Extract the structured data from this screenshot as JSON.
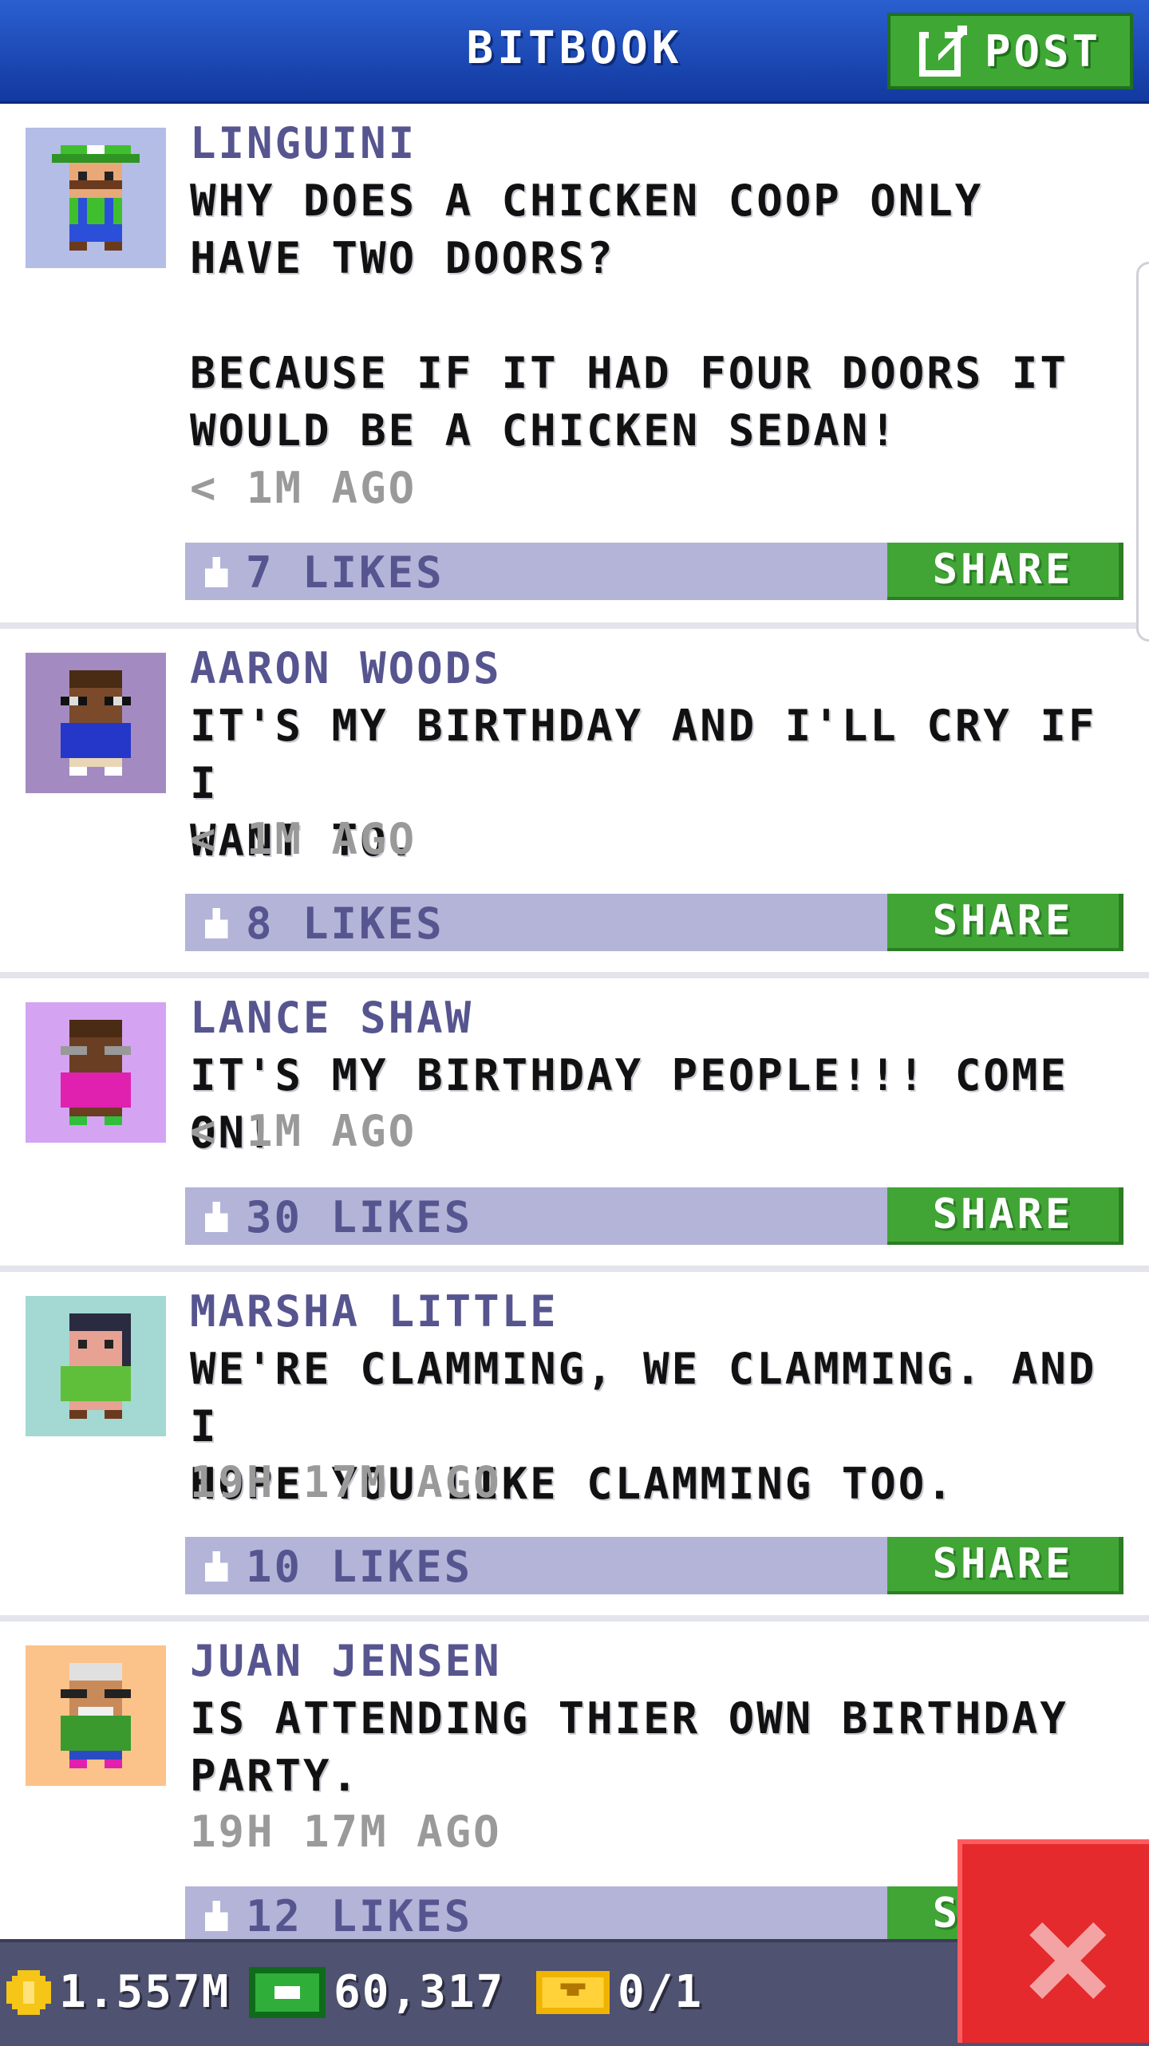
{
  "header": {
    "title": "BITBOOK",
    "post_label": "POST"
  },
  "colors": {
    "header_blue": "#1f4fbf",
    "button_green": "#41a536",
    "likes_bar": "#b3b4d8",
    "name_purple": "#57558f",
    "close_red": "#e52a2e"
  },
  "posts": [
    {
      "name": "LINGUINI",
      "message": "WHY DOES A CHICKEN COOP ONLY\nHAVE TWO DOORS?\n\nBECAUSE IF IT HAD FOUR DOORS IT\nWOULD BE A CHICKEN SEDAN!",
      "time": "< 1M AGO",
      "likes": "7 LIKES",
      "share_label": "SHARE",
      "avatar_icon": "green-cap-mustache-avatar-icon"
    },
    {
      "name": "AARON WOODS",
      "message": "IT'S MY BIRTHDAY AND I'LL CRY IF I\nWANT TO.",
      "time": "< 1M AGO",
      "likes": "8 LIKES",
      "share_label": "SHARE",
      "avatar_icon": "glasses-blue-shirt-avatar-icon"
    },
    {
      "name": "LANCE SHAW",
      "message": "IT'S MY BIRTHDAY PEOPLE!!! COME ON!",
      "time": "< 1M AGO",
      "likes": "30 LIKES",
      "share_label": "SHARE",
      "avatar_icon": "glasses-pink-shirt-avatar-icon"
    },
    {
      "name": "MARSHA LITTLE",
      "message": "WE'RE CLAMMING, WE CLAMMING. AND I\nHOPE YOU LIKE CLAMMING TOO.",
      "time": "19H 17M AGO",
      "likes": "10 LIKES",
      "share_label": "SHARE",
      "avatar_icon": "dark-hair-green-shirt-avatar-icon"
    },
    {
      "name": "JUAN JENSEN",
      "message": "IS ATTENDING THIER OWN BIRTHDAY\nPARTY.",
      "time": "19H 17M AGO",
      "likes": "12 LIKES",
      "share_label": "SHARE",
      "avatar_icon": "grey-hair-glasses-avatar-icon"
    }
  ],
  "footer": {
    "coins": "1.557M",
    "bux": "60,317",
    "tickets": "0/1"
  }
}
